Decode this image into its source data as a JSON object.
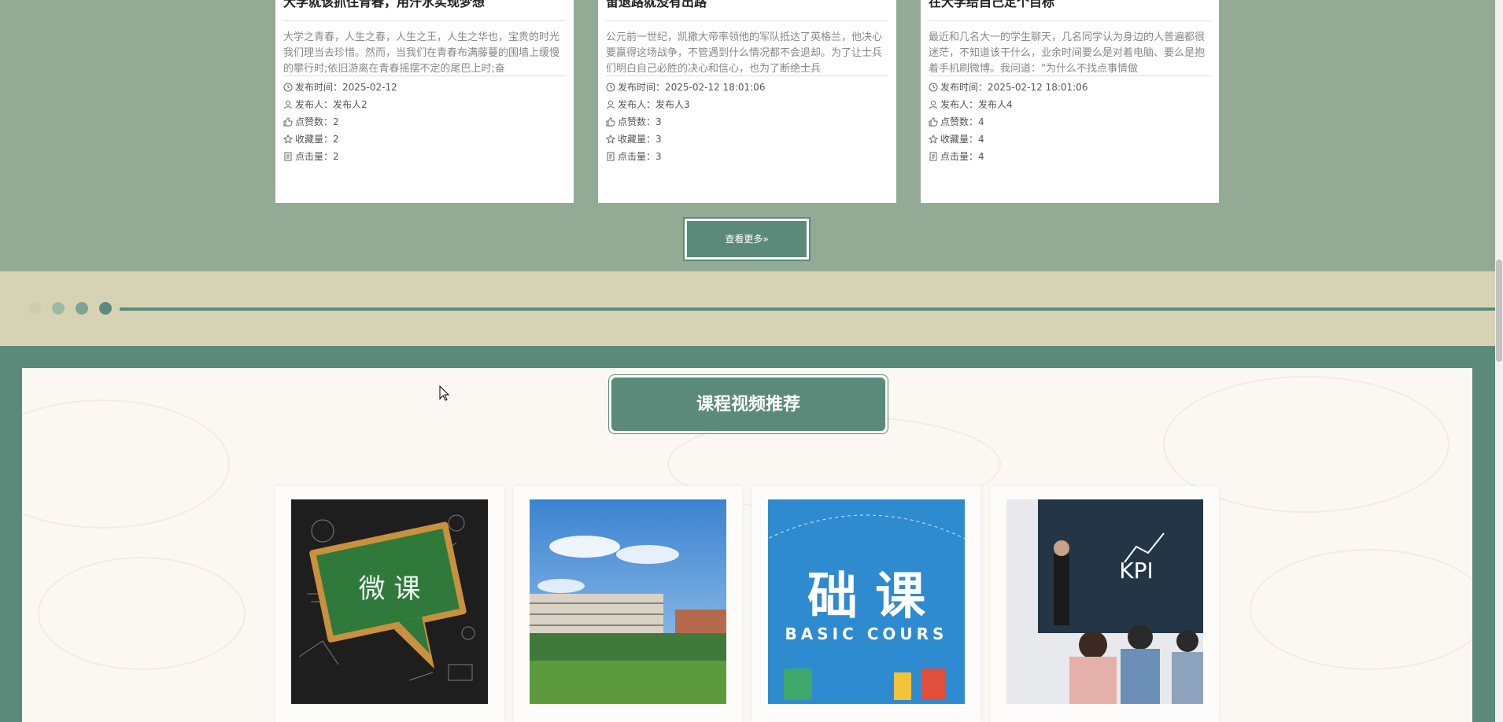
{
  "news": {
    "items": [
      {
        "title": "大学就该抓住青春，用汗水实现梦想",
        "summary": "大学之青春，人生之春，人生之王，人生之华也，宝贵的时光我们理当去珍惜。然而，当我们在青春布满藤蔓的围墙上缓慢的攀行时;依旧游离在青春摇摆不定的尾巴上时;奋",
        "publish_time": "发布时间：2025-02-12",
        "publisher": "发布人：发布人2",
        "likes": "点赞数：2",
        "favorites": "收藏量：2",
        "clicks": "点击量：2"
      },
      {
        "title": "留退路就没有出路",
        "summary": "公元前一世纪，凯撒大帝率领他的军队抵达了英格兰，他决心要赢得这场战争，不管遇到什么情况都不会退却。为了让士兵们明白自己必胜的决心和信心，也为了断绝士兵",
        "publish_time": "发布时间：2025-02-12 18:01:06",
        "publisher": "发布人：发布人3",
        "likes": "点赞数：3",
        "favorites": "收藏量：3",
        "clicks": "点击量：3"
      },
      {
        "title": "在大学给自己定个目标",
        "summary": "最近和几名大一的学生聊天，几名同学认为身边的人普遍都很迷茫，不知道该干什么，业余时间要么是对着电脑、要么是抱着手机刷微博。我问道：\"为什么不找点事情做",
        "publish_time": "发布时间：2025-02-12 18:01:06",
        "publisher": "发布人：发布人4",
        "likes": "点赞数：4",
        "favorites": "收藏量：4",
        "clicks": "点击量：4"
      }
    ],
    "more_label": "查看更多»"
  },
  "divider": {
    "dot_colors": [
      "#cfccab",
      "#9fb8a5",
      "#7ea293",
      "#5b8a7b"
    ],
    "line_color": "#5b8a7b"
  },
  "videos": {
    "heading": "课程视频推荐",
    "items": [
      {
        "thumb_text": "微 课",
        "icon": "chalkboard-speech-bubble"
      },
      {
        "thumb_text": "",
        "icon": "campus-building"
      },
      {
        "thumb_text_1": "础 课",
        "thumb_text_2": "BASIC COURS",
        "icon": "basic-course-poster"
      },
      {
        "thumb_text": "KPI",
        "icon": "classroom-presentation"
      }
    ]
  },
  "colors": {
    "accent": "#5b8a7b",
    "news_bg": "#93ab95",
    "band_bg": "#d6d3b4",
    "panel_bg": "#fbf8f3"
  }
}
